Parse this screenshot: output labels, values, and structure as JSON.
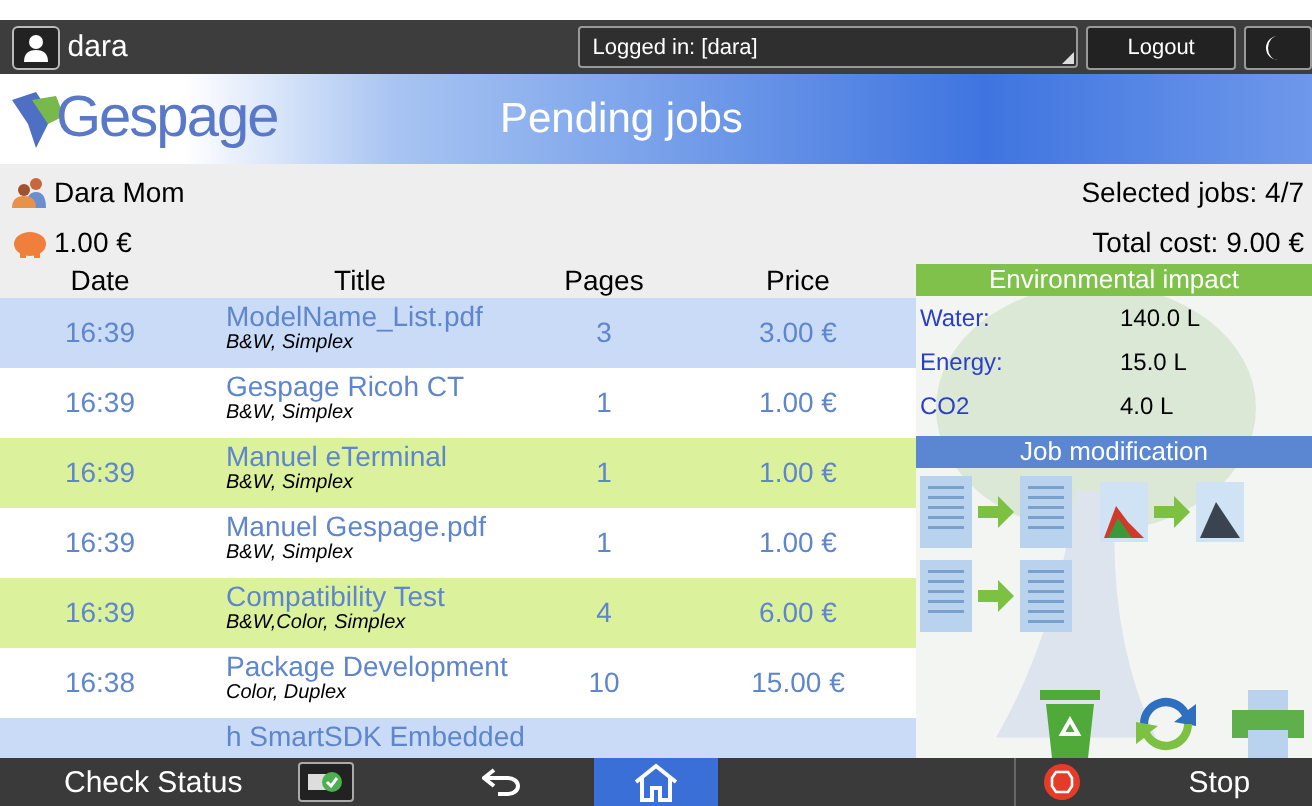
{
  "top_bar": {
    "user": "dara",
    "login_field": "Logged in: [dara]",
    "logout": "Logout"
  },
  "header": {
    "logo": "Gespage",
    "title": "Pending jobs"
  },
  "account": {
    "name": "Dara Mom",
    "balance": "1.00 €",
    "selected_jobs": "Selected jobs: 4/7",
    "total_cost": "Total cost: 9.00 €"
  },
  "table": {
    "columns": [
      "Date",
      "Title",
      "Pages",
      "Price"
    ],
    "rows": [
      {
        "date": "16:39",
        "title": "ModelName_List.pdf",
        "options": "B&W, Simplex",
        "pages": "3",
        "price": "3.00 €",
        "color": "#c9dbf6"
      },
      {
        "date": "16:39",
        "title": "Gespage Ricoh CT",
        "options": "B&W, Simplex",
        "pages": "1",
        "price": "1.00 €",
        "color": "#ffffff"
      },
      {
        "date": "16:39",
        "title": "Manuel eTerminal",
        "options": "B&W, Simplex",
        "pages": "1",
        "price": "1.00 €",
        "color": "#dcf19c"
      },
      {
        "date": "16:39",
        "title": "Manuel Gespage.pdf",
        "options": "B&W, Simplex",
        "pages": "1",
        "price": "1.00 €",
        "color": "#ffffff"
      },
      {
        "date": "16:39",
        "title": "Compatibility Test",
        "options": "B&W,Color, Simplex",
        "pages": "4",
        "price": "6.00 €",
        "color": "#dcf19c"
      },
      {
        "date": "16:38",
        "title": "Package Development",
        "options": "Color, Duplex",
        "pages": "10",
        "price": "15.00 €",
        "color": "#ffffff"
      },
      {
        "title": "h SmartSDK Embedded",
        "color": "#c9dbf6"
      }
    ]
  },
  "environmental_impact": {
    "title": "Environmental impact",
    "items": [
      {
        "label": "Water:",
        "value": "140.0 L"
      },
      {
        "label": "Energy:",
        "value": "15.0 L"
      },
      {
        "label": "CO2",
        "value": "4.0 L"
      }
    ]
  },
  "job_modification": {
    "title": "Job modification"
  },
  "bottom_bar": {
    "check_status": "Check Status",
    "stop": "Stop"
  }
}
